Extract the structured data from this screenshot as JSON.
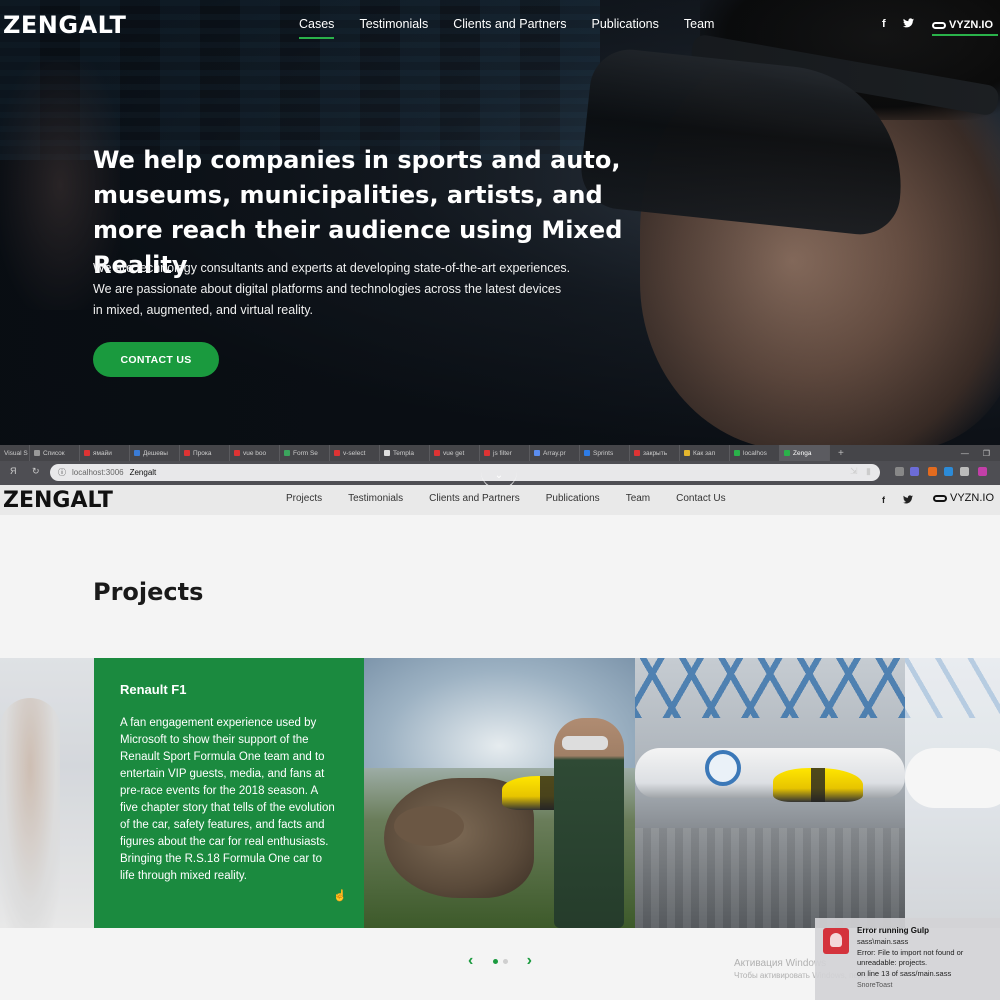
{
  "hero_nav": {
    "logo": "ZENGALT",
    "links": [
      "Cases",
      "Testimonials",
      "Clients and Partners",
      "Publications",
      "Team"
    ],
    "active_link": "Cases",
    "social": [
      "f",
      "twitter-icon"
    ],
    "vyzn": "VYZN.IO"
  },
  "hero": {
    "title": "We help companies in sports and auto, museums, municipalities, artists, and more reach their audience using Mixed Reality",
    "subtitle": "We are technology consultants and experts at developing state-of-the-art experiences. We are passionate about digital platforms and technologies across the latest devices in mixed, augmented, and virtual reality.",
    "cta": "CONTACT US"
  },
  "browser": {
    "tabs": [
      "Visual S",
      "Список",
      "ямайи",
      "Дешевы",
      "Прока",
      "vue boo",
      "Form Se",
      "v-select",
      "Templa",
      "vue get",
      "js filter",
      "Array.pr",
      "Sprints",
      "закрыть",
      "Как зап",
      "localhos",
      "Zenga"
    ],
    "active_tab": "Zenga",
    "url_host": "localhost:3006",
    "url_title": "Zengalt",
    "nav_glyph": "Я"
  },
  "nav2": {
    "logo": "ZENGALT",
    "links": [
      "Projects",
      "Testimonials",
      "Clients and Partners",
      "Publications",
      "Team",
      "Contact Us"
    ],
    "vyzn": "VYZN.IO"
  },
  "projects": {
    "title": "Projects",
    "card_title": "Renault F1",
    "card_desc": "A fan engagement experience used by Microsoft to show their support of the Renault Sport Formula One team and to entertain VIP guests, media, and fans at pre-race events for the 2018 season. A five chapter story that tells of the evolution of the car, safety features, and facts and figures about the car for real enthusiasts. Bringing the R.S.18 Formula One car to life through mixed reality.",
    "page_count": 2,
    "active_page": 1
  },
  "windows": {
    "activate_line1": "Активация Windows",
    "activate_line2": "Чтобы активировать Windows, перей..."
  },
  "toast": {
    "title": "Error running Gulp",
    "line1": "sass\\main.sass",
    "line2": "Error: File to import not found or unreadable: projects.",
    "line3": "on line 13 of sass/main.sass",
    "app": "SnoreToast"
  },
  "colors": {
    "accent": "#1a9a3e",
    "card": "#1b8a3f"
  }
}
